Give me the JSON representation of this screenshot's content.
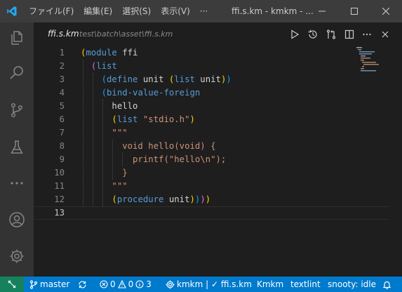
{
  "titlebar": {
    "menu": [
      "ファイル(F)",
      "編集(E)",
      "選択(S)",
      "表示(V)",
      "···"
    ],
    "window_title": "ffi.s.km - kmkm - ..."
  },
  "tab": {
    "title": "ffi.s.km",
    "path": "test\\batch\\asset\\ffi.s.km"
  },
  "editor": {
    "line_numbers": [
      "1",
      "2",
      "3",
      "4",
      "5",
      "6",
      "7",
      "8",
      "9",
      "10",
      "11",
      "12",
      "13"
    ],
    "current_line": 13
  },
  "statusbar": {
    "branch": "master",
    "errors": "0",
    "warnings": "0",
    "info": "3",
    "project": "kmkm | ✓ ffi.s.km",
    "language": "Kmkm",
    "linter": "textlint",
    "snooty": "snooty: idle"
  },
  "colors": {
    "keyword": "#569cd6",
    "string": "#ce9178",
    "bracket_level1": "#ffd700",
    "bracket_level2": "#da70d6",
    "bracket_level3": "#179fff",
    "statusbar": "#007acc",
    "remote": "#16825d"
  }
}
